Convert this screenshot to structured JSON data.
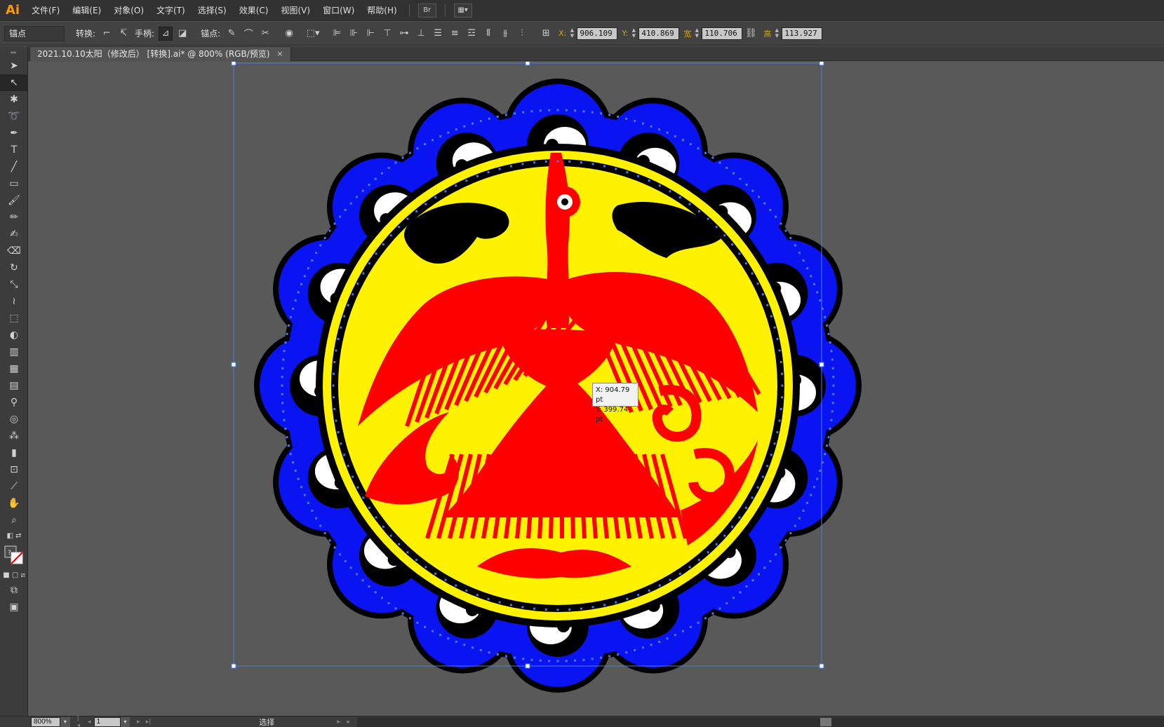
{
  "app": {
    "logo": "Ai",
    "menus": [
      "文件(F)",
      "编辑(E)",
      "对象(O)",
      "文字(T)",
      "选择(S)",
      "效果(C)",
      "视图(V)",
      "窗口(W)",
      "帮助(H)"
    ],
    "bridge_icon": "bridge-icon",
    "arrange_icon": "arrange-documents-icon"
  },
  "control_bar": {
    "selection_type": "锚点",
    "convert_label": "转换:",
    "handles_label": "手柄:",
    "anchor_label": "锚点:",
    "x_label": "X:",
    "x_value": "906.109",
    "y_label": "Y:",
    "y_value": "410.869",
    "w_label": "宽",
    "w_value": "110.706",
    "h_label": "高",
    "h_value": "113.927"
  },
  "document": {
    "tab_title": "2021.10.10太阳（修改后） [转换].ai* @ 800% (RGB/预览)",
    "close": "×"
  },
  "tooltip": {
    "x": "X: 904.79 pt",
    "y": "Y: 399.74 pt"
  },
  "status_bar": {
    "zoom": "800%",
    "page": "1",
    "status": "选择"
  },
  "colors": {
    "blue": "#0a14f0",
    "yellow": "#fff200",
    "red": "#ff0000",
    "black": "#000000",
    "white": "#ffffff",
    "path": "#4a7be8"
  },
  "tools": [
    "selection-tool",
    "direct-selection-tool",
    "magic-wand-tool",
    "lasso-tool",
    "pen-tool",
    "type-tool",
    "line-tool",
    "rectangle-tool",
    "paintbrush-tool",
    "pencil-tool",
    "blob-brush-tool",
    "eraser-tool",
    "rotate-tool",
    "scale-tool",
    "warp-tool",
    "free-transform-tool",
    "shape-builder-tool",
    "perspective-grid-tool",
    "mesh-tool",
    "gradient-tool",
    "eyedropper-tool",
    "blend-tool",
    "symbol-sprayer-tool",
    "column-graph-tool",
    "artboard-tool",
    "slice-tool",
    "hand-tool",
    "zoom-tool"
  ]
}
